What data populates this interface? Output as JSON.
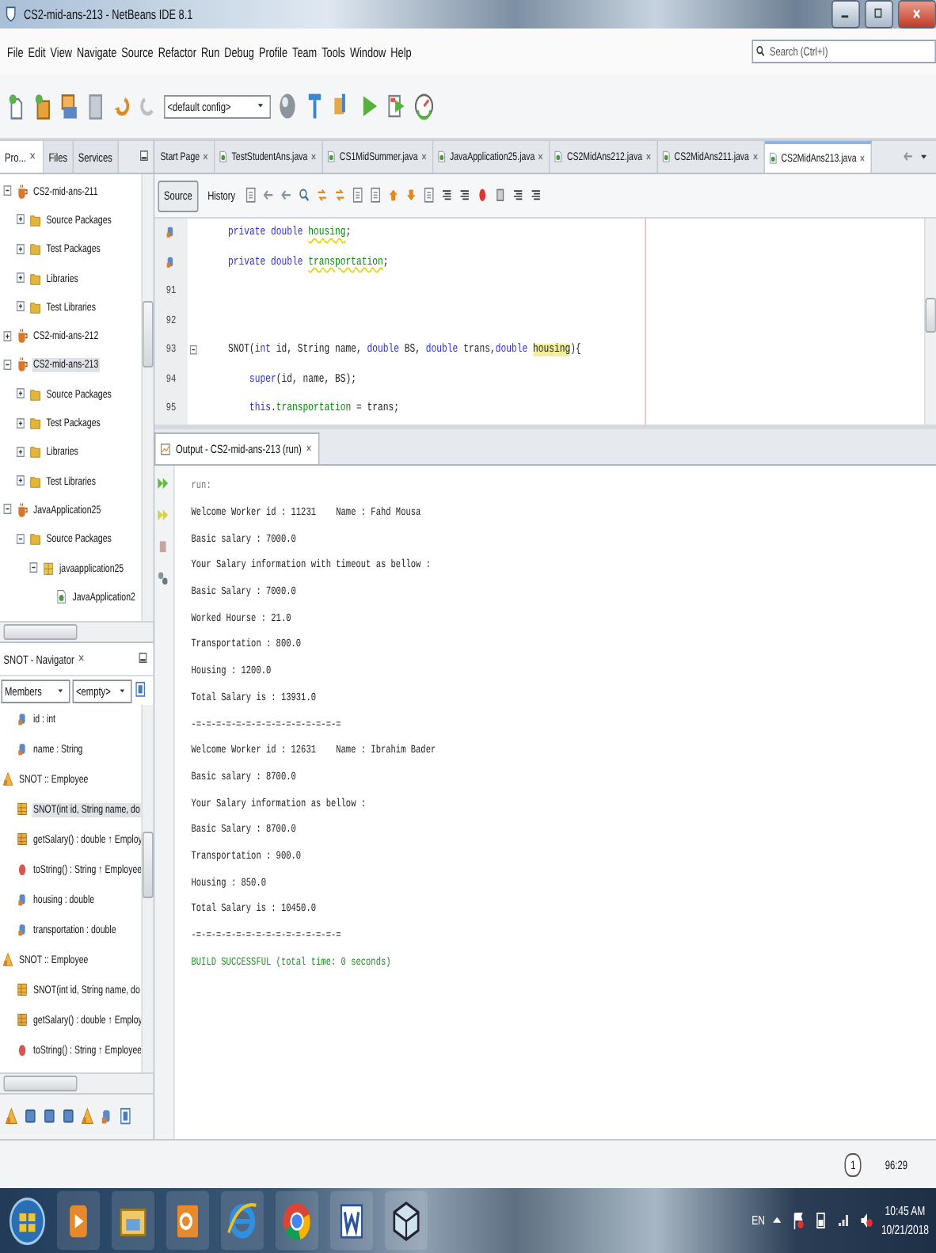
{
  "window": {
    "title": "CS2-mid-ans-213 - NetBeans IDE 8.1"
  },
  "menu": [
    "File",
    "Edit",
    "View",
    "Navigate",
    "Source",
    "Refactor",
    "Run",
    "Debug",
    "Profile",
    "Team",
    "Tools",
    "Window",
    "Help"
  ],
  "search": {
    "placeholder": "Search (Ctrl+I)"
  },
  "toolbar": {
    "config": "<default config>"
  },
  "projects": {
    "tabs": [
      {
        "label": "Pro...",
        "selected": true
      },
      {
        "label": "Files",
        "selected": false
      },
      {
        "label": "Services",
        "selected": false
      }
    ],
    "tree": [
      {
        "label": "CS2-mid-ans-211",
        "kind": "project",
        "expanded": true,
        "selected": false,
        "children": [
          {
            "label": "Source Packages",
            "kind": "folder",
            "expanded": false,
            "selected": false
          },
          {
            "label": "Test Packages",
            "kind": "folder",
            "expanded": false,
            "selected": false
          },
          {
            "label": "Libraries",
            "kind": "folder",
            "expanded": false,
            "selected": false
          },
          {
            "label": "Test Libraries",
            "kind": "folder",
            "expanded": false,
            "selected": false
          }
        ]
      },
      {
        "label": "CS2-mid-ans-212",
        "kind": "project",
        "expanded": false,
        "selected": false
      },
      {
        "label": "CS2-mid-ans-213",
        "kind": "project",
        "expanded": true,
        "selected": true,
        "children": [
          {
            "label": "Source Packages",
            "kind": "folder",
            "expanded": false,
            "selected": false
          },
          {
            "label": "Test Packages",
            "kind": "folder",
            "expanded": false,
            "selected": false
          },
          {
            "label": "Libraries",
            "kind": "folder",
            "expanded": false,
            "selected": false
          },
          {
            "label": "Test Libraries",
            "kind": "folder",
            "expanded": false,
            "selected": false
          }
        ]
      },
      {
        "label": "JavaApplication25",
        "kind": "project",
        "expanded": true,
        "selected": false,
        "children": [
          {
            "label": "Source Packages",
            "kind": "folder",
            "expanded": true,
            "selected": false,
            "children": [
              {
                "label": "javaapplication25",
                "kind": "package",
                "expanded": true,
                "selected": false,
                "children": [
                  {
                    "label": "JavaApplication2",
                    "kind": "java",
                    "selected": false
                  }
                ]
              }
            ]
          }
        ]
      }
    ]
  },
  "navigator": {
    "title": "SNOT - Navigator",
    "filter": "Members",
    "scope": "<empty>",
    "tree": [
      {
        "label": "id : int",
        "kind": "field",
        "selected": false
      },
      {
        "label": "name : String",
        "kind": "field",
        "selected": false
      },
      {
        "label": "SNOT :: Employee",
        "kind": "class",
        "selected": false,
        "children": [
          {
            "label": "SNOT(int id, String name, do",
            "kind": "constructor",
            "selected": true
          },
          {
            "label": "getSalary() : double ↑ Employ",
            "kind": "method",
            "selected": false
          },
          {
            "label": "toString() : String ↑ Employee",
            "kind": "override",
            "selected": false
          },
          {
            "label": "housing : double",
            "kind": "field",
            "selected": false
          },
          {
            "label": "transportation : double",
            "kind": "field",
            "selected": false
          }
        ]
      },
      {
        "label": "SNOT :: Employee",
        "kind": "class",
        "selected": false,
        "children": [
          {
            "label": "SNOT(int id, String name, do",
            "kind": "constructor",
            "selected": false
          },
          {
            "label": "getSalary() : double ↑ Employ",
            "kind": "method",
            "selected": false
          },
          {
            "label": "toString() : String ↑ Employee",
            "kind": "override",
            "selected": false
          }
        ]
      }
    ]
  },
  "editor": {
    "tabs": [
      {
        "label": "Start Page",
        "kind": "page",
        "selected": false
      },
      {
        "label": "TestStudentAns.java",
        "kind": "java",
        "selected": false
      },
      {
        "label": "CS1MidSummer.java",
        "kind": "java",
        "selected": false
      },
      {
        "label": "JavaApplication25.java",
        "kind": "java",
        "selected": false
      },
      {
        "label": "CS2MidAns212.java",
        "kind": "java",
        "selected": false
      },
      {
        "label": "CS2MidAns211.java",
        "kind": "java",
        "selected": false
      },
      {
        "label": "CS2MidAns213.java",
        "kind": "java",
        "selected": true
      }
    ],
    "views": [
      {
        "label": "Source",
        "selected": true
      },
      {
        "label": "History",
        "selected": false
      }
    ],
    "lines": [
      {
        "hint": true,
        "fold": false,
        "tokens": [
          {
            "kind": "keyword",
            "text": "    private double "
          },
          {
            "kind": "unused",
            "text": "housing"
          },
          {
            "kind": "plain",
            "text": ";"
          }
        ]
      },
      {
        "hint": true,
        "fold": false,
        "tokens": [
          {
            "kind": "keyword",
            "text": "    private double "
          },
          {
            "kind": "unused",
            "text": "transportation"
          },
          {
            "kind": "plain",
            "text": ";"
          }
        ]
      },
      {
        "number": "91",
        "hint": false,
        "fold": false
      },
      {
        "number": "92",
        "hint": false,
        "fold": false
      },
      {
        "number": "93",
        "hint": false,
        "fold": true,
        "tokens": [
          {
            "kind": "plain",
            "text": "    SNOT("
          },
          {
            "kind": "keyword",
            "text": "int"
          },
          {
            "kind": "plain",
            "text": " id, String name, "
          },
          {
            "kind": "keyword",
            "text": "double"
          },
          {
            "kind": "plain",
            "text": " BS, "
          },
          {
            "kind": "keyword",
            "text": "double"
          },
          {
            "kind": "plain",
            "text": " trans,"
          },
          {
            "kind": "keyword",
            "text": "double "
          },
          {
            "kind": "marked",
            "text": "housing"
          },
          {
            "kind": "plain",
            "text": "){"
          }
        ]
      },
      {
        "number": "94",
        "hint": false,
        "fold": false,
        "tokens": [
          {
            "kind": "keyword",
            "text": "        super"
          },
          {
            "kind": "plain",
            "text": "(id, name, BS);"
          }
        ]
      },
      {
        "number": "95",
        "hint": false,
        "fold": false,
        "tokens": [
          {
            "kind": "keyword",
            "text": "        this"
          },
          {
            "kind": "plain",
            "text": "."
          },
          {
            "kind": "field",
            "text": "transportation"
          },
          {
            "kind": "plain",
            "text": " = trans;"
          }
        ]
      }
    ]
  },
  "output": {
    "title": "Output - CS2-mid-ans-213 (run)",
    "lines": [
      {
        "kind": "meta",
        "text": "run:"
      },
      {
        "kind": "text",
        "text": "Welcome Worker id : 11231    Name : Fahd Mousa"
      },
      {
        "kind": "text",
        "text": "Basic salary : 7000.0"
      },
      {
        "kind": "text",
        "text": "Your Salary information with timeout as bellow :"
      },
      {
        "kind": "text",
        "text": "Basic Salary : 7000.0"
      },
      {
        "kind": "text",
        "text": "Worked Hourse : 21.0"
      },
      {
        "kind": "text",
        "text": "Transportation : 800.0"
      },
      {
        "kind": "text",
        "text": "Housing : 1200.0"
      },
      {
        "kind": "text",
        "text": "Total Salary is : 13931.0"
      },
      {
        "kind": "text",
        "text": "-=-=-=-=-=-=-=-=-=-=-=-=-=-=-="
      },
      {
        "kind": "text",
        "text": "Welcome Worker id : 12631    Name : Ibrahim Bader"
      },
      {
        "kind": "text",
        "text": "Basic salary : 8700.0"
      },
      {
        "kind": "text",
        "text": "Your Salary information as bellow :"
      },
      {
        "kind": "text",
        "text": "Basic Salary : 8700.0"
      },
      {
        "kind": "text",
        "text": "Transportation : 900.0"
      },
      {
        "kind": "text",
        "text": "Housing : 850.0"
      },
      {
        "kind": "text",
        "text": "Total Salary is : 10450.0"
      },
      {
        "kind": "text",
        "text": "-=-=-=-=-=-=-=-=-=-=-=-=-=-=-="
      },
      {
        "kind": "success",
        "text": "BUILD SUCCESSFUL (total time: 0 seconds)"
      }
    ]
  },
  "status_bar": {
    "notifications": "1",
    "position": "96:29"
  },
  "taskbar": {
    "language": "EN",
    "time": "10:45 AM",
    "date": "10/21/2018"
  }
}
